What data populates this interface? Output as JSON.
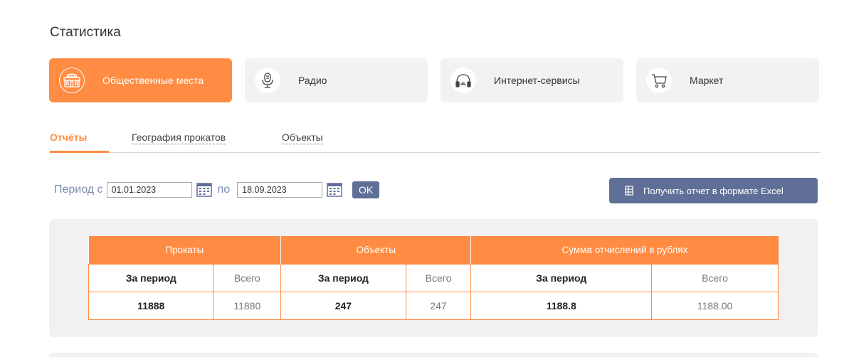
{
  "page": {
    "title": "Статистика"
  },
  "categories": [
    {
      "label": "Общественные места",
      "icon": "building-icon",
      "active": true
    },
    {
      "label": "Радио",
      "icon": "microphone-icon",
      "active": false
    },
    {
      "label": "Интернет-сервисы",
      "icon": "headphones-icon",
      "active": false
    },
    {
      "label": "Маркет",
      "icon": "cart-icon",
      "active": false
    }
  ],
  "tabs": [
    {
      "label": "Отчёты",
      "active": true
    },
    {
      "label": "География прокатов",
      "active": false
    },
    {
      "label": "Объекты",
      "active": false
    }
  ],
  "period": {
    "from_label": "Период с",
    "from_value": "01.01.2023",
    "to_label": "по",
    "to_value": "18.09.2023",
    "ok_label": "OK"
  },
  "excel_button": {
    "label": "Получить отчет в формате Excel"
  },
  "table": {
    "groups": [
      "Прокаты",
      "Объекты",
      "Сумма отчислений в рублях"
    ],
    "subheaders": [
      "За период",
      "Всего",
      "За период",
      "Всего",
      "За период",
      "Всего"
    ],
    "values": [
      "11888",
      "11880",
      "247",
      "247",
      "1188.8",
      "1188.00"
    ]
  },
  "colors": {
    "accent": "#ff8c42",
    "button": "#5f6f97",
    "panel": "#f1f1f1"
  }
}
